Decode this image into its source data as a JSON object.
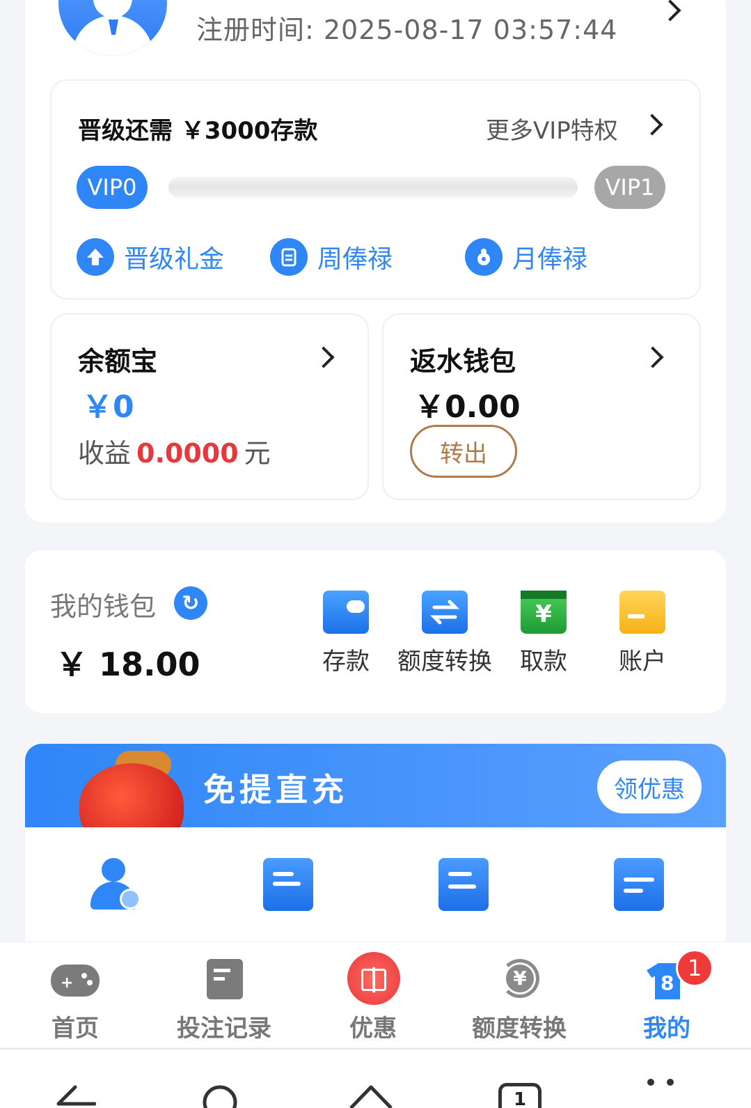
{
  "profile": {
    "reg_time": "注册时间: 2025-08-17 03:57:44"
  },
  "vip": {
    "upgrade_text": "晋级还需 ￥3000存款",
    "more_label": "更多VIP特权",
    "current_level": "VIP0",
    "next_level": "VIP1",
    "progress": 0,
    "perks": [
      {
        "label": "晋级礼金",
        "icon": "arrow-up-icon"
      },
      {
        "label": "周俸禄",
        "icon": "clipboard-icon"
      },
      {
        "label": "月俸禄",
        "icon": "money-bag-icon"
      }
    ]
  },
  "yuebao": {
    "title": "余额宝",
    "amount": "￥0",
    "earn_prefix": "收益",
    "earn_value": "0.0000",
    "earn_unit": "元"
  },
  "rebate": {
    "title": "返水钱包",
    "amount": "￥0.00",
    "out_label": "转出"
  },
  "wallet": {
    "title": "我的钱包",
    "amount": "￥ 18.00",
    "actions": [
      {
        "label": "存款",
        "icon": "wallet-icon"
      },
      {
        "label": "额度转换",
        "icon": "transfer-icon"
      },
      {
        "label": "取款",
        "icon": "withdraw-icon"
      },
      {
        "label": "账户",
        "icon": "card-icon"
      }
    ]
  },
  "promo": {
    "title": "免提直充",
    "button": "领优惠"
  },
  "nav": {
    "items": [
      {
        "label": "首页",
        "icon": "gamepad-icon"
      },
      {
        "label": "投注记录",
        "icon": "document-icon"
      },
      {
        "label": "优惠",
        "icon": "gift-icon"
      },
      {
        "label": "额度转换",
        "icon": "yuan-exchange-icon"
      },
      {
        "label": "我的",
        "icon": "shirt-icon"
      }
    ],
    "badge": "1",
    "shirt_number": "8"
  },
  "system": {
    "tabs_count": "1"
  },
  "colors": {
    "accent": "#2f86f6",
    "red": "#e8383d",
    "brown": "#b07a4b"
  }
}
